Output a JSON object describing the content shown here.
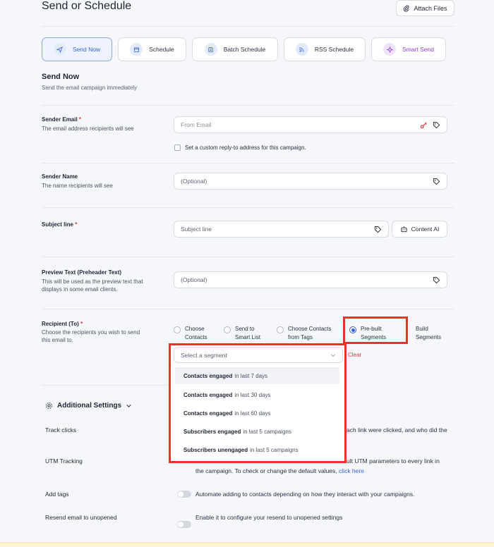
{
  "header": {
    "title": "Send or Schedule",
    "attach_label": "Attach Files"
  },
  "tabs": [
    {
      "label": "Send Now",
      "icon": "paper-plane-icon"
    },
    {
      "label": "Schedule",
      "icon": "calendar-icon"
    },
    {
      "label": "Batch Schedule",
      "icon": "batch-calendar-icon"
    },
    {
      "label": "RSS Schedule",
      "icon": "rss-icon"
    },
    {
      "label": "Smart Send",
      "icon": "sparkle-icon"
    }
  ],
  "section": {
    "title": "Send Now",
    "subtitle": "Send the email campaign immediately"
  },
  "sender_email": {
    "label": "Sender Email",
    "required": "*",
    "help": "The email address recipients will see",
    "placeholder": "From Email",
    "reply_to_label": "Set a custom reply-to address for this campaign."
  },
  "sender_name": {
    "label": "Sender Name",
    "help": "The name recipients will see",
    "placeholder": "(Optional)"
  },
  "subject": {
    "label": "Subject line",
    "required": "*",
    "placeholder": "Subject line",
    "content_ai_label": "Content AI"
  },
  "preview": {
    "label": "Preview Text (Preheader Text)",
    "help_line1": "This will be used as the preview text that",
    "help_line2": "displays in some email clients.",
    "placeholder": "(Optional)"
  },
  "recipient": {
    "label": "Recipient (To)",
    "required": "*",
    "help_line1": "Choose the recipients you wish to send",
    "help_line2": "this email to.",
    "options": [
      {
        "line1": "Choose",
        "line2": "Contacts"
      },
      {
        "line1": "Send to",
        "line2": "Smart List"
      },
      {
        "line1": "Choose Contacts",
        "line2": "from Tags"
      },
      {
        "line1": "Pre-built",
        "line2": "Segments"
      },
      {
        "line1": "Build",
        "line2": "Segments"
      }
    ],
    "selected": "Pre-built Segments",
    "segment_placeholder": "Select a segment",
    "clear_label": "Clear"
  },
  "segments": [
    {
      "bold": "Contacts engaged",
      "rest": "in last 7 days"
    },
    {
      "bold": "Contacts engaged",
      "rest": "in last 30 days"
    },
    {
      "bold": "Contacts engaged",
      "rest": "in last 60 days"
    },
    {
      "bold": "Subscribers engaged",
      "rest": "in last 5 campaigns"
    },
    {
      "bold": "Subscribers unengaged",
      "rest": "in last 5 campaigns"
    }
  ],
  "additional": {
    "title": "Additional Settings",
    "track_clicks": {
      "label": "Track clicks",
      "desc": "ach link were clicked, and who did the"
    },
    "utm": {
      "label": "UTM Tracking",
      "desc_line1": "ult UTM parameters to every link in",
      "desc_line2": "the campaign. To check or change the default values,",
      "link": "click here"
    },
    "add_tags": {
      "label": "Add tags",
      "desc": "Automate adding to contacts depending on how they interact with your campaigns."
    },
    "resend": {
      "label": "Resend email to unopened",
      "desc": "Enable it to configure your resend to unopened settings"
    }
  },
  "colors": {
    "accent": "#3462d6",
    "highlight": "#e8322a",
    "smart_send": "#8b3fd9"
  }
}
